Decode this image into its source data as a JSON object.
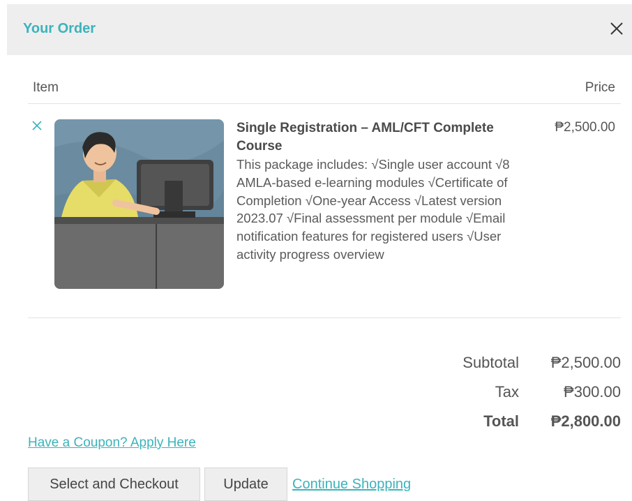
{
  "dialog": {
    "title": "Your Order",
    "close_icon": "close-icon",
    "accent_color": "#3cb3bb"
  },
  "table": {
    "col_item": "Item",
    "col_price": "Price"
  },
  "line_item": {
    "name": "Single Registration – AML/CFT Complete Course",
    "description": "This package includes: √Single user account √8 AMLA-based e-learning modules √Certificate of Completion √One-year Access √Latest version 2023.07 √Final assessment per module √Email notification features for registered users √User activity progress overview",
    "price": "₱2,500.00",
    "remove_icon": "remove-x-icon"
  },
  "summary": {
    "subtotal_label": "Subtotal",
    "subtotal_value": "₱2,500.00",
    "tax_label": "Tax",
    "tax_value": "₱300.00",
    "total_label": "Total",
    "total_value": "₱2,800.00"
  },
  "actions": {
    "coupon_link": "Have a Coupon? Apply Here",
    "checkout_button": "Select and Checkout",
    "update_button": "Update",
    "continue_link": "Continue Shopping"
  }
}
